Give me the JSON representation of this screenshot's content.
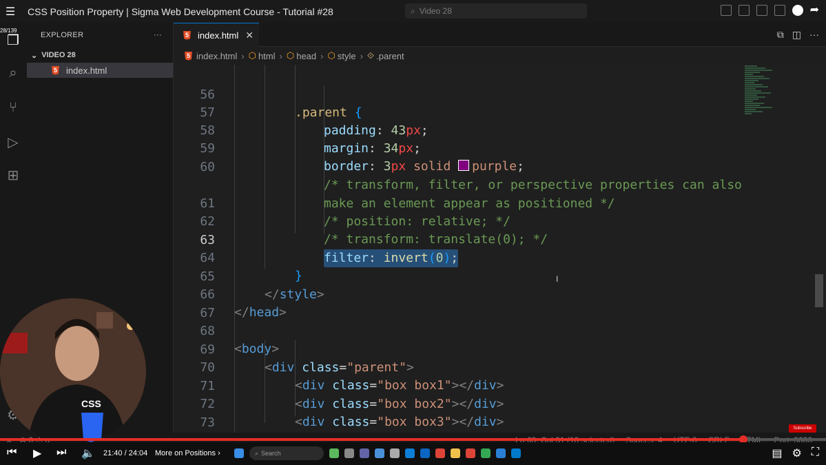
{
  "video": {
    "title": "CSS Position Property | Sigma Web Development Course - Tutorial #28",
    "search_placeholder": "Video 28",
    "playlist_counter": "28/139",
    "time": "21:40 / 24:04",
    "chapter": "More on Positions",
    "progress_fraction": 0.9,
    "subscribe_label": "Subscribe"
  },
  "sidebar": {
    "header": "EXPLORER",
    "more": "···",
    "folder": "VIDEO 28",
    "file": "index.html"
  },
  "tab": {
    "label": "index.html",
    "close": "✕"
  },
  "breadcrumbs": [
    "index.html",
    "html",
    "head",
    "style",
    ".parent"
  ],
  "editor": {
    "current_line": "63",
    "lines": [
      {
        "num": "56",
        "code": ".parent {"
      },
      {
        "num": "57",
        "code": "padding: 43px;"
      },
      {
        "num": "58",
        "code": "margin: 34px;"
      },
      {
        "num": "59",
        "code": "border: 3px solid purple;"
      },
      {
        "num": "60",
        "code": "/* transform, filter, or perspective properties can also"
      },
      {
        "num": "",
        "code": "make an element appear as positioned */"
      },
      {
        "num": "61",
        "code": "/* position: relative; */"
      },
      {
        "num": "62",
        "code": "/* transform: translate(0); */"
      },
      {
        "num": "63",
        "code": "filter: invert(0);"
      },
      {
        "num": "64",
        "code": "}"
      },
      {
        "num": "65",
        "code": "</style>"
      },
      {
        "num": "66",
        "code": "</head>"
      },
      {
        "num": "67",
        "code": ""
      },
      {
        "num": "68",
        "code": "<body>"
      },
      {
        "num": "69",
        "code": "<div class=\"parent\">"
      },
      {
        "num": "70",
        "code": "<div class=\"box box1\"></div>"
      },
      {
        "num": "71",
        "code": "<div class=\"box box2\"></div>"
      },
      {
        "num": "72",
        "code": "<div class=\"box box3\"></div>"
      },
      {
        "num": "73",
        "code": "<div class=\"box box4\"></div>"
      },
      {
        "num": "74",
        "code": "</div>"
      }
    ]
  },
  "status": {
    "position": "Ln 63, Col 31 (18 selected)",
    "spaces": "Spaces: 4",
    "encoding": "UTF-8",
    "eol": "CRLF",
    "language": "HTML",
    "port": "Port: 3000"
  },
  "taskbar": {
    "search_placeholder": "Search"
  },
  "colors": {
    "accent": "#0078d4",
    "progress": "#e52d27",
    "swatch": "#800080"
  }
}
